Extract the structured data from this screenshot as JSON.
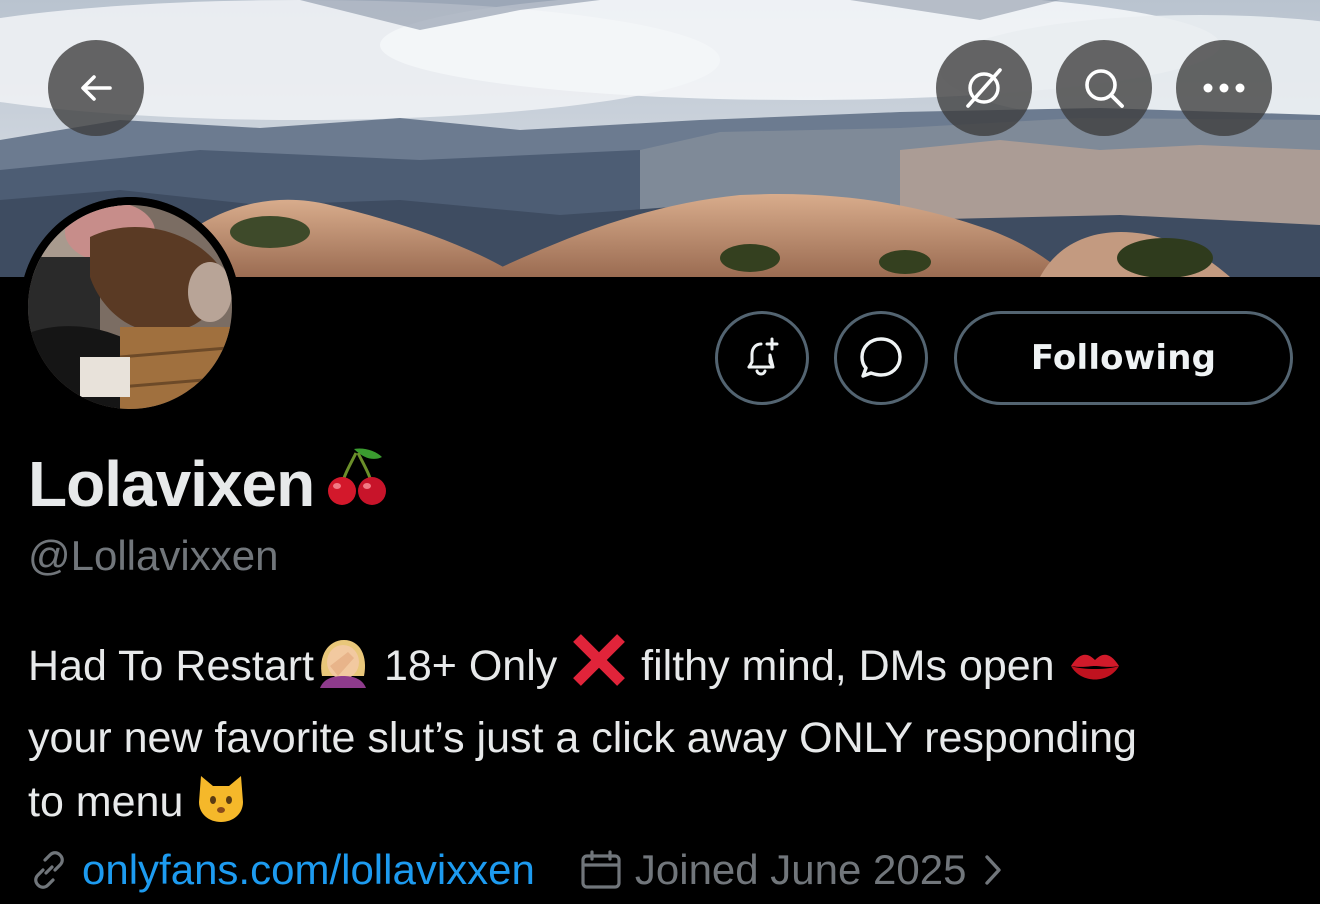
{
  "header": {
    "back_icon": "arrow-left-icon",
    "grok_icon": "grok-icon",
    "search_icon": "search-icon",
    "more_icon": "more-horizontal-icon"
  },
  "profile": {
    "display_name": "Lolavixen",
    "name_emoji": "cherries",
    "handle": "@Lollavixxen",
    "bio": {
      "line1_a": "Had To Restart",
      "line1_b": " 18+ Only ",
      "line1_c": " filthy mind, DMs open ",
      "line2": "your new favorite slut’s just a click away ONLY responding",
      "line3": "to menu "
    },
    "link": "onlyfans.com/lollavixxen",
    "joined": "Joined June 2025"
  },
  "actions": {
    "notify_icon": "bell-plus-icon",
    "message_icon": "message-bubble-icon",
    "following_label": "Following"
  },
  "colors": {
    "background": "#000000",
    "text": "#e7e9ea",
    "muted": "#71767b",
    "link": "#1d9bf0",
    "border": "#536471"
  }
}
